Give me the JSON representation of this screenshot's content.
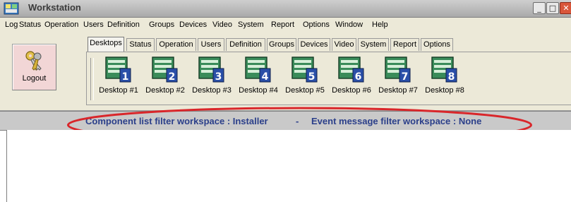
{
  "window": {
    "title": "Workstation",
    "controls": {
      "minimize": "_",
      "maximize": "□",
      "close": "✕"
    }
  },
  "menu": {
    "items": [
      "Log",
      "Status",
      "Operation",
      "Users",
      "Definition",
      "Groups",
      "Devices",
      "Video",
      "System",
      "Report",
      "Options",
      "Window",
      "Help"
    ]
  },
  "toolbar": {
    "logout_label": "Logout",
    "tabs": [
      "Desktops",
      "Status",
      "Operation",
      "Users",
      "Definition",
      "Groups",
      "Devices",
      "Video",
      "System",
      "Report",
      "Options"
    ],
    "active_tab": "Desktops",
    "desktops": [
      {
        "label": "Desktop #1",
        "number": "1"
      },
      {
        "label": "Desktop #2",
        "number": "2"
      },
      {
        "label": "Desktop #3",
        "number": "3"
      },
      {
        "label": "Desktop #4",
        "number": "4"
      },
      {
        "label": "Desktop #5",
        "number": "5"
      },
      {
        "label": "Desktop #6",
        "number": "6"
      },
      {
        "label": "Desktop #7",
        "number": "7"
      },
      {
        "label": "Desktop #8",
        "number": "8"
      }
    ]
  },
  "status_bar": {
    "component_filter": "Component list filter workspace : Installer",
    "separator": "-",
    "event_filter": "Event message filter workspace : None"
  },
  "colors": {
    "status_text": "#2b3f8a",
    "highlight_ring": "#d9262a",
    "desktop_icon_green": "#3a8c5a",
    "desktop_icon_blue": "#2a4fa8"
  },
  "icons": {
    "app": "workstation-app-icon",
    "logout": "keys-icon",
    "desktop": "desktop-window-icon"
  }
}
